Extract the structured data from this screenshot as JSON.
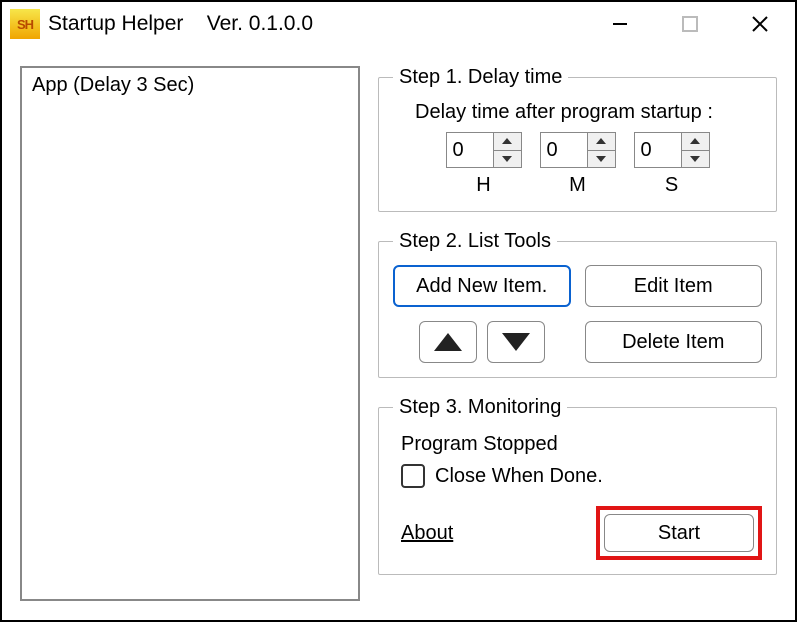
{
  "window": {
    "app_name": "Startup Helper",
    "version_label": "Ver. 0.1.0.0",
    "logo_text": "SH"
  },
  "list": {
    "items": [
      "App (Delay 3 Sec)"
    ]
  },
  "step1": {
    "legend": "Step 1. Delay time",
    "label": "Delay time after program startup :",
    "hours": "0",
    "minutes": "0",
    "seconds": "0",
    "unit_h": "H",
    "unit_m": "M",
    "unit_s": "S"
  },
  "step2": {
    "legend": "Step 2. List Tools",
    "add_label": "Add New Item.",
    "edit_label": "Edit Item",
    "delete_label": "Delete Item"
  },
  "step3": {
    "legend": "Step 3. Monitoring",
    "status": "Program Stopped",
    "close_when_done_label": "Close When Done.",
    "close_when_done_checked": false,
    "about_label": "About",
    "start_label": "Start"
  }
}
